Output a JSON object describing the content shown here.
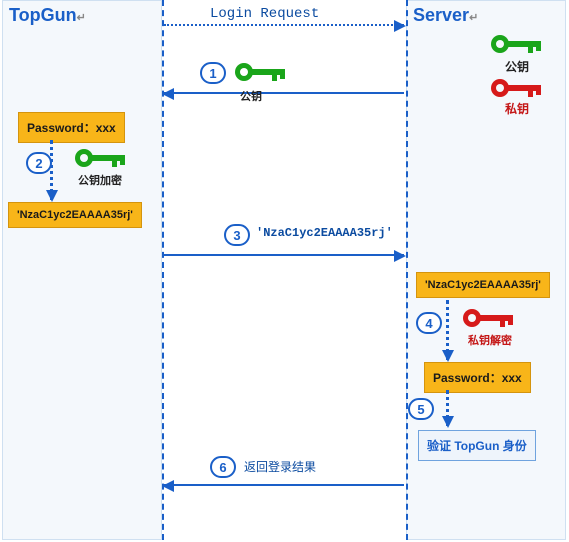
{
  "client": {
    "title": "TopGun"
  },
  "server": {
    "title": "Server"
  },
  "request_label": "Login Request",
  "keys": {
    "public_label": "公钥",
    "private_label": "私钥",
    "public_encrypt_label": "公钥加密",
    "private_decrypt_label": "私钥解密",
    "public_color": "#1aa51a",
    "private_color": "#d61a1a"
  },
  "boxes": {
    "password_plain": "Password：xxx",
    "cipher": "'NzaC1yc2EAAAA35rj'",
    "cipher_msg": "'NzaC1yc2EAAAA35rj'",
    "password_decoded": "Password：xxx",
    "verify": "验证 TopGun 身份"
  },
  "labels": {
    "return_result": "返回登录结果"
  },
  "steps": {
    "s1": "1",
    "s2": "2",
    "s3": "3",
    "s4": "4",
    "s5": "5",
    "s6": "6"
  },
  "suffix": "↵"
}
